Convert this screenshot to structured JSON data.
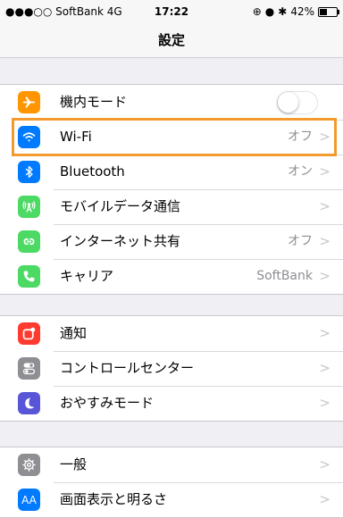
{
  "status_bar": {
    "carrier": "●●●○○ SoftBank 4G",
    "time": "17:22",
    "battery": "42%",
    "battery_level": 0.42
  },
  "nav": {
    "title": "設定"
  },
  "group1": [
    {
      "label": "機内モード",
      "icon": "airplane-icon",
      "color": "#ff9500",
      "toggle": true,
      "toggle_on": false
    },
    {
      "label": "Wi-Fi",
      "icon": "wifi-icon",
      "color": "#007aff",
      "value": "オフ",
      "highlighted": true
    },
    {
      "label": "Bluetooth",
      "icon": "bluetooth-icon",
      "color": "#007aff",
      "value": "オン"
    },
    {
      "label": "モバイルデータ通信",
      "icon": "cellular-antenna-icon",
      "color": "#4cd964",
      "value": ""
    },
    {
      "label": "インターネット共有",
      "icon": "link-icon",
      "color": "#4cd964",
      "value": "オフ"
    },
    {
      "label": "キャリア",
      "icon": "phone-icon",
      "color": "#4cd964",
      "value": "SoftBank"
    }
  ],
  "group2": [
    {
      "label": "通知",
      "icon": "notification-icon",
      "color": "#ff3b30"
    },
    {
      "label": "コントロールセンター",
      "icon": "switches-icon",
      "color": "#8e8e93"
    },
    {
      "label": "おやすみモード",
      "icon": "moon-icon",
      "color": "#5856d6"
    }
  ],
  "group3": [
    {
      "label": "一般",
      "icon": "gear-icon",
      "color": "#8e8e93"
    },
    {
      "label": "画面表示と明るさ",
      "icon": "text-size-icon",
      "color": "#007aff"
    }
  ],
  "chevron": ">",
  "icon_texts": {
    "text_size": "AA"
  }
}
